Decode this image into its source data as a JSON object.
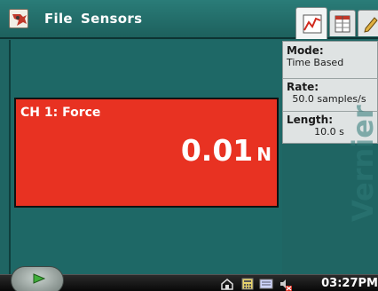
{
  "menu": {
    "file_label": "File",
    "sensors_label": "Sensors"
  },
  "tabs": [
    "graph",
    "table",
    "notes"
  ],
  "meter": {
    "channel_label": "CH 1: Force",
    "value": "0.01",
    "unit": "N"
  },
  "info": {
    "mode_label": "Mode:",
    "mode_value": "Time Based",
    "rate_label": "Rate:",
    "rate_value": "50.0 samples/s",
    "length_label": "Length:",
    "length_value": "10.0 s"
  },
  "taskbar": {
    "clock": "03:27PM"
  },
  "colors": {
    "background": "#1f6563",
    "meter_red": "#e83222",
    "panel": "#dfe3e3"
  }
}
